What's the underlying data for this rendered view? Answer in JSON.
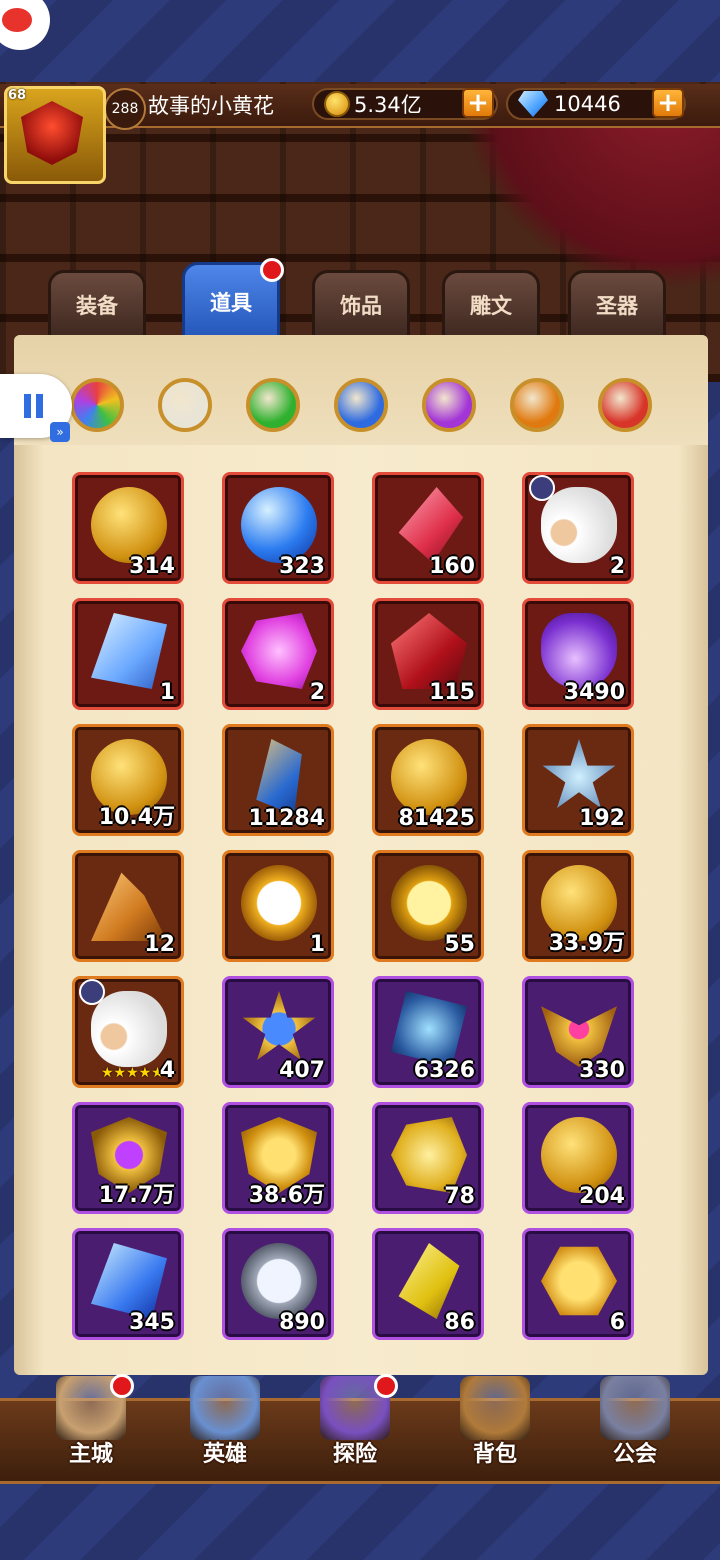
{
  "player": {
    "level": "68",
    "power_badge": "288",
    "name": "故事的小黄花"
  },
  "currency": {
    "gold": "5.34亿",
    "diamonds": "10446",
    "add_label": "+"
  },
  "tabs": [
    {
      "label": "装备",
      "active": false
    },
    {
      "label": "道具",
      "active": true,
      "has_notification": true
    },
    {
      "label": "饰品",
      "active": false
    },
    {
      "label": "雕文",
      "active": false
    },
    {
      "label": "圣器",
      "active": false
    }
  ],
  "filters": [
    "all-colors",
    "white",
    "green",
    "blue",
    "purple",
    "orange",
    "red"
  ],
  "filter_colors": {
    "white": "#e8e4d6",
    "green": "#2fb12f",
    "blue": "#2e6be0",
    "purple": "#a335d6",
    "orange": "#e07a10",
    "red": "#d8352a"
  },
  "items": [
    {
      "icon": "eagle-coin-icon",
      "count": "314",
      "rarity": "red"
    },
    {
      "icon": "blue-egg-icon",
      "count": "323",
      "rarity": "red"
    },
    {
      "icon": "red-crystal-shard-icon",
      "count": "160",
      "rarity": "red"
    },
    {
      "icon": "sheep-hero-icon",
      "count": "2",
      "rarity": "red"
    },
    {
      "icon": "rune-stone-icon",
      "count": "1",
      "rarity": "red"
    },
    {
      "icon": "pink-puzzle-icon",
      "count": "2",
      "rarity": "red"
    },
    {
      "icon": "red-crystal-cluster-icon",
      "count": "115",
      "rarity": "red"
    },
    {
      "icon": "purple-potion-icon",
      "count": "3490",
      "rarity": "red"
    },
    {
      "icon": "skull-coin-icon",
      "count": "10.4万",
      "rarity": "orange"
    },
    {
      "icon": "blue-shard-icon",
      "count": "11284",
      "rarity": "orange"
    },
    {
      "icon": "gold-coin-icon",
      "count": "81425",
      "rarity": "orange"
    },
    {
      "icon": "ice-star-icon",
      "count": "192",
      "rarity": "orange"
    },
    {
      "icon": "sand-pile-icon",
      "count": "12",
      "rarity": "orange"
    },
    {
      "icon": "stopwatch-icon",
      "count": "1",
      "rarity": "orange"
    },
    {
      "icon": "magnifier-gold-icon",
      "count": "55",
      "rarity": "orange"
    },
    {
      "icon": "small-gold-coin-icon",
      "count": "33.9万",
      "rarity": "orange"
    },
    {
      "icon": "sheep-hero-icon",
      "count": "4",
      "rarity": "orange",
      "stars": "★★★★★"
    },
    {
      "icon": "blue-gem-badge-icon",
      "count": "407",
      "rarity": "purple"
    },
    {
      "icon": "storm-stone-icon",
      "count": "6326",
      "rarity": "purple"
    },
    {
      "icon": "winged-emblem-icon",
      "count": "330",
      "rarity": "purple"
    },
    {
      "icon": "gem-shield-icon",
      "count": "17.7万",
      "rarity": "purple"
    },
    {
      "icon": "gold-shield-icon",
      "count": "38.6万",
      "rarity": "purple"
    },
    {
      "icon": "gold-puzzle-icon",
      "count": "78",
      "rarity": "purple"
    },
    {
      "icon": "m-coin-icon",
      "count": "204",
      "rarity": "purple"
    },
    {
      "icon": "blue-ice-crystal-icon",
      "count": "345",
      "rarity": "purple"
    },
    {
      "icon": "magnifier-silver-icon",
      "count": "890",
      "rarity": "purple"
    },
    {
      "icon": "yellow-crystal-icon",
      "count": "86",
      "rarity": "purple"
    },
    {
      "icon": "hex-coin-icon",
      "count": "6",
      "rarity": "purple"
    }
  ],
  "nav": [
    {
      "label": "主城",
      "icon": "castle-icon",
      "has_notification": true
    },
    {
      "label": "英雄",
      "icon": "hero-portrait-icon",
      "has_notification": false
    },
    {
      "label": "探险",
      "icon": "portal-icon",
      "has_notification": true
    },
    {
      "label": "背包",
      "icon": "backpack-icon",
      "has_notification": false
    },
    {
      "label": "公会",
      "icon": "guild-tower-icon",
      "has_notification": false
    }
  ]
}
